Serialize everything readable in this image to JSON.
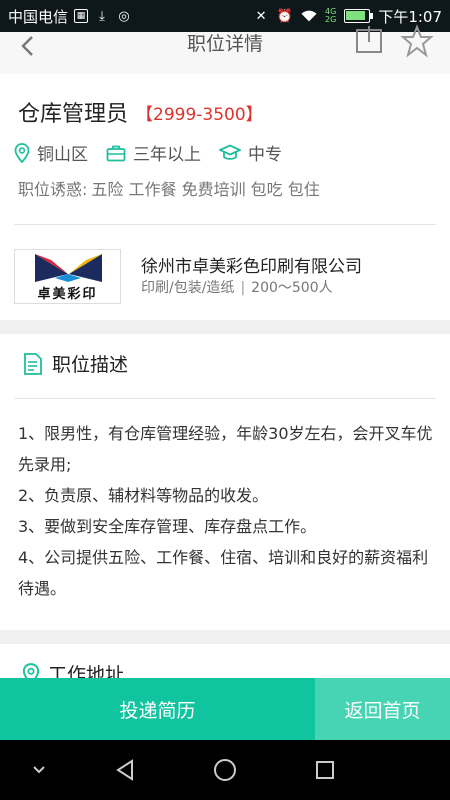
{
  "status_bar": {
    "carrier": "中国电信",
    "network_top": "4G",
    "network_bottom": "2G",
    "time": "下午1:07"
  },
  "header": {
    "title": "职位详情"
  },
  "job": {
    "title": "仓库管理员",
    "salary": "【2999-3500】",
    "location": "铜山区",
    "experience": "三年以上",
    "education": "中专",
    "perks_label": "职位诱惑:",
    "perks_value": "五险 工作餐 免费培训 包吃 包住"
  },
  "company": {
    "logo_text": "卓美彩印",
    "name": "徐州市卓美彩色印刷有限公司",
    "industry": "印刷/包装/造纸",
    "size": "200～500人"
  },
  "description": {
    "heading": "职位描述",
    "items": [
      "1、限男性，有仓库管理经验，年龄30岁左右，会开叉车优先录用;",
      "2、负责原、辅材料等物品的收发。",
      "3、要做到安全库存管理、库存盘点工作。",
      "4、公司提供五险、工作餐、住宿、培训和良好的薪资福利待遇。"
    ]
  },
  "address": {
    "heading": "工作地址"
  },
  "actions": {
    "apply": "投递简历",
    "home": "返回首页"
  },
  "colors": {
    "accent": "#11c4a0",
    "accent_light": "#46d4b4",
    "salary_red": "#e0322d"
  }
}
